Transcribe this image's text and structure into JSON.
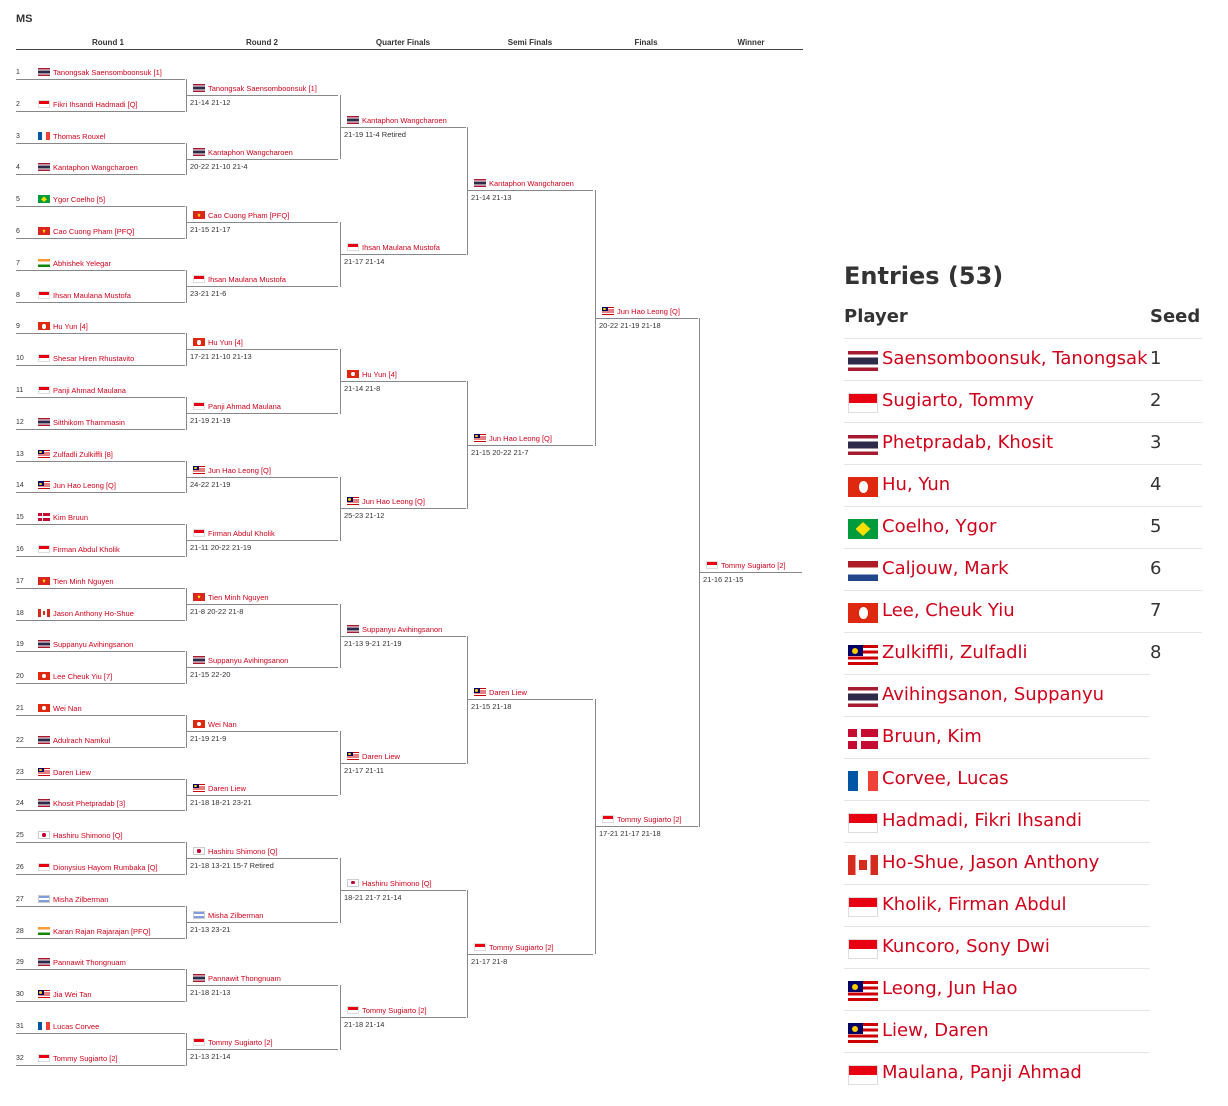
{
  "event": "MS",
  "rounds": [
    "Round 1",
    "Round 2",
    "Quarter Finals",
    "Semi Finals",
    "Finals",
    "Winner"
  ],
  "round1": [
    {
      "num": "1",
      "name": "Tanongsak Saensomboonsuk [1]",
      "flag": "th"
    },
    {
      "num": "2",
      "name": "Fikri Ihsandi Hadmadi [Q]",
      "flag": "id"
    },
    {
      "num": "3",
      "name": "Thomas Rouxel",
      "flag": "fr"
    },
    {
      "num": "4",
      "name": "Kantaphon Wangcharoen",
      "flag": "th"
    },
    {
      "num": "5",
      "name": "Ygor Coelho [5]",
      "flag": "br"
    },
    {
      "num": "6",
      "name": "Cao Cuong Pham [PFQ]",
      "flag": "vn"
    },
    {
      "num": "7",
      "name": "Abhishek Yelegar",
      "flag": "in"
    },
    {
      "num": "8",
      "name": "Ihsan Maulana Mustofa",
      "flag": "id"
    },
    {
      "num": "9",
      "name": "Hu Yun [4]",
      "flag": "hk"
    },
    {
      "num": "10",
      "name": "Shesar Hiren Rhustavito",
      "flag": "id"
    },
    {
      "num": "11",
      "name": "Panji Ahmad Maulana",
      "flag": "id"
    },
    {
      "num": "12",
      "name": "Sitthikom Thammasin",
      "flag": "th"
    },
    {
      "num": "13",
      "name": "Zulfadli Zulkiffli [8]",
      "flag": "my"
    },
    {
      "num": "14",
      "name": "Jun Hao Leong [Q]",
      "flag": "my"
    },
    {
      "num": "15",
      "name": "Kim Bruun",
      "flag": "dk"
    },
    {
      "num": "16",
      "name": "Firman Abdul Kholik",
      "flag": "id"
    },
    {
      "num": "17",
      "name": "Tien Minh Nguyen",
      "flag": "vn"
    },
    {
      "num": "18",
      "name": "Jason Anthony Ho-Shue",
      "flag": "ca"
    },
    {
      "num": "19",
      "name": "Suppanyu Avihingsanon",
      "flag": "th"
    },
    {
      "num": "20",
      "name": "Lee Cheuk Yiu [7]",
      "flag": "hk"
    },
    {
      "num": "21",
      "name": "Wei Nan",
      "flag": "hk"
    },
    {
      "num": "22",
      "name": "Adulrach Namkul",
      "flag": "th"
    },
    {
      "num": "23",
      "name": "Daren Liew",
      "flag": "my"
    },
    {
      "num": "24",
      "name": "Khosit Phetpradab [3]",
      "flag": "th"
    },
    {
      "num": "25",
      "name": "Hashiru Shimono [Q]",
      "flag": "jp"
    },
    {
      "num": "26",
      "name": "Dionysius Hayom Rumbaka [Q]",
      "flag": "id"
    },
    {
      "num": "27",
      "name": "Misha Zilberman",
      "flag": "il"
    },
    {
      "num": "28",
      "name": "Karan Rajan Rajarajan [PFQ]",
      "flag": "in"
    },
    {
      "num": "29",
      "name": "Pannawit Thongnuam",
      "flag": "th"
    },
    {
      "num": "30",
      "name": "Jia Wei Tan",
      "flag": "my"
    },
    {
      "num": "31",
      "name": "Lucas Corvee",
      "flag": "fr"
    },
    {
      "num": "32",
      "name": "Tommy Sugiarto [2]",
      "flag": "id"
    }
  ],
  "round2": [
    {
      "name": "Tanongsak Saensomboonsuk [1]",
      "flag": "th",
      "score": "21-14  21-12"
    },
    {
      "name": "Kantaphon Wangcharoen",
      "flag": "th",
      "score": "20-22  21-10  21-4"
    },
    {
      "name": "Cao Cuong Pham [PFQ]",
      "flag": "vn",
      "score": "21-15  21-17"
    },
    {
      "name": "Ihsan Maulana Mustofa",
      "flag": "id",
      "score": "23-21  21-6"
    },
    {
      "name": "Hu Yun [4]",
      "flag": "hk",
      "score": "17-21  21-10  21-13"
    },
    {
      "name": "Panji Ahmad Maulana",
      "flag": "id",
      "score": "21-19  21-19"
    },
    {
      "name": "Jun Hao Leong [Q]",
      "flag": "my",
      "score": "24-22  21-19"
    },
    {
      "name": "Firman Abdul Kholik",
      "flag": "id",
      "score": "21-11  20-22  21-19"
    },
    {
      "name": "Tien Minh Nguyen",
      "flag": "vn",
      "score": "21-8  20-22  21-8"
    },
    {
      "name": "Suppanyu Avihingsanon",
      "flag": "th",
      "score": "21-15  22-20"
    },
    {
      "name": "Wei Nan",
      "flag": "hk",
      "score": "21-19  21-9"
    },
    {
      "name": "Daren Liew",
      "flag": "my",
      "score": "21-18  18-21  23-21"
    },
    {
      "name": "Hashiru Shimono [Q]",
      "flag": "jp",
      "score": "21-18  13-21  15-7   Retired"
    },
    {
      "name": "Misha Zilberman",
      "flag": "il",
      "score": "21-13  23-21"
    },
    {
      "name": "Pannawit Thongnuam",
      "flag": "th",
      "score": "21-18  21-13"
    },
    {
      "name": "Tommy Sugiarto [2]",
      "flag": "id",
      "score": "21-13  21-14"
    }
  ],
  "quarter": [
    {
      "name": "Kantaphon Wangcharoen",
      "flag": "th",
      "score": "21-19  11-4   Retired"
    },
    {
      "name": "Ihsan Maulana Mustofa",
      "flag": "id",
      "score": "21-17  21-14"
    },
    {
      "name": "Hu Yun [4]",
      "flag": "hk",
      "score": "21-14  21-8"
    },
    {
      "name": "Jun Hao Leong [Q]",
      "flag": "my",
      "score": "25-23  21-12"
    },
    {
      "name": "Suppanyu Avihingsanon",
      "flag": "th",
      "score": "21-13  9-21  21-19"
    },
    {
      "name": "Daren Liew",
      "flag": "my",
      "score": "21-17  21-11"
    },
    {
      "name": "Hashiru Shimono [Q]",
      "flag": "jp",
      "score": "18-21  21-7  21-14"
    },
    {
      "name": "Tommy Sugiarto [2]",
      "flag": "id",
      "score": "21-18  21-14"
    }
  ],
  "semi": [
    {
      "name": "Kantaphon Wangcharoen",
      "flag": "th",
      "score": "21-14  21-13"
    },
    {
      "name": "Jun Hao Leong [Q]",
      "flag": "my",
      "score": "21-15  20-22  21-7"
    },
    {
      "name": "Daren Liew",
      "flag": "my",
      "score": "21-15  21-18"
    },
    {
      "name": "Tommy Sugiarto [2]",
      "flag": "id",
      "score": "21-17  21-8"
    }
  ],
  "finals": [
    {
      "name": "Jun Hao Leong [Q]",
      "flag": "my",
      "score": "20-22  21-19  21-18"
    },
    {
      "name": "Tommy Sugiarto [2]",
      "flag": "id",
      "score": "17-21  21-17  21-18"
    }
  ],
  "winner": {
    "name": "Tommy Sugiarto [2]",
    "flag": "id",
    "score": "21-16  21-15"
  },
  "entries": {
    "title": "Entries (53)",
    "col_player": "Player",
    "col_seed": "Seed",
    "rows": [
      {
        "name": "Saensomboonsuk, Tanongsak",
        "seed": "1",
        "flag": "th"
      },
      {
        "name": "Sugiarto, Tommy",
        "seed": "2",
        "flag": "id"
      },
      {
        "name": "Phetpradab, Khosit",
        "seed": "3",
        "flag": "th"
      },
      {
        "name": "Hu, Yun",
        "seed": "4",
        "flag": "hk"
      },
      {
        "name": "Coelho, Ygor",
        "seed": "5",
        "flag": "br"
      },
      {
        "name": "Caljouw, Mark",
        "seed": "6",
        "flag": "nl"
      },
      {
        "name": "Lee, Cheuk Yiu",
        "seed": "7",
        "flag": "hk"
      },
      {
        "name": "Zulkiffli, Zulfadli",
        "seed": "8",
        "flag": "my"
      },
      {
        "name": "Avihingsanon, Suppanyu",
        "seed": "",
        "flag": "th"
      },
      {
        "name": "Bruun, Kim",
        "seed": "",
        "flag": "dk"
      },
      {
        "name": "Corvee, Lucas",
        "seed": "",
        "flag": "fr"
      },
      {
        "name": "Hadmadi, Fikri Ihsandi",
        "seed": "",
        "flag": "id"
      },
      {
        "name": "Ho-Shue, Jason Anthony",
        "seed": "",
        "flag": "ca"
      },
      {
        "name": "Kholik, Firman Abdul",
        "seed": "",
        "flag": "id"
      },
      {
        "name": "Kuncoro, Sony Dwi",
        "seed": "",
        "flag": "id"
      },
      {
        "name": "Leong, Jun Hao",
        "seed": "",
        "flag": "my"
      },
      {
        "name": "Liew, Daren",
        "seed": "",
        "flag": "my"
      },
      {
        "name": "Maulana, Panji Ahmad",
        "seed": "",
        "flag": "id"
      }
    ]
  }
}
